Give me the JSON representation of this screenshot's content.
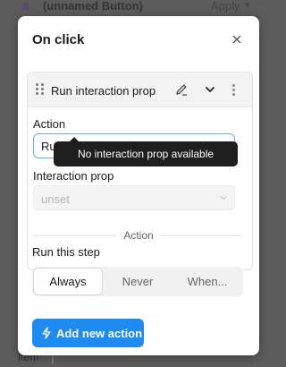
{
  "background": {
    "title": "(unnamed Button)",
    "apply_label": "Apply",
    "bottom_text": "Item"
  },
  "panel": {
    "title": "On click"
  },
  "step": {
    "title": "Run interaction prop",
    "action_label": "Action",
    "action_value": "Ru",
    "interaction_prop_label": "Interaction prop",
    "interaction_prop_value": "unset",
    "divider_label": "Action",
    "run_label": "Run this step",
    "run_options": [
      "Always",
      "Never",
      "When..."
    ],
    "run_selected": "Always"
  },
  "add_button": {
    "label": "Add new action"
  },
  "tooltip": {
    "text": "No interaction prop available"
  },
  "colors": {
    "accent": "#1d8bf0",
    "focus": "#6aa7ee",
    "tooltip_bg": "#1e1e1e"
  },
  "icons": [
    "drag-handle-icon",
    "edit-icon",
    "chevron-down-icon",
    "more-icon",
    "close-icon",
    "lightning-icon"
  ]
}
